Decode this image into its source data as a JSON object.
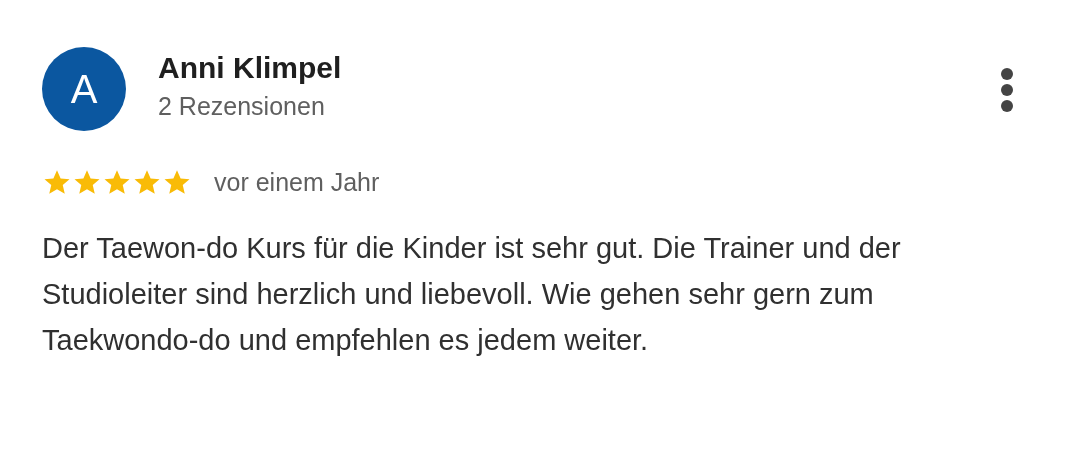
{
  "review": {
    "avatar_letter": "A",
    "author": "Anni Klimpel",
    "author_meta": "2 Rezensionen",
    "stars": 5,
    "time": "vor einem Jahr",
    "text": "Der Taewon-do Kurs für die Kinder ist sehr gut. Die Trainer und der Studioleiter sind herzlich und liebevoll. Wie gehen sehr gern zum Taekwondo-do und empfehlen es jedem weiter."
  }
}
